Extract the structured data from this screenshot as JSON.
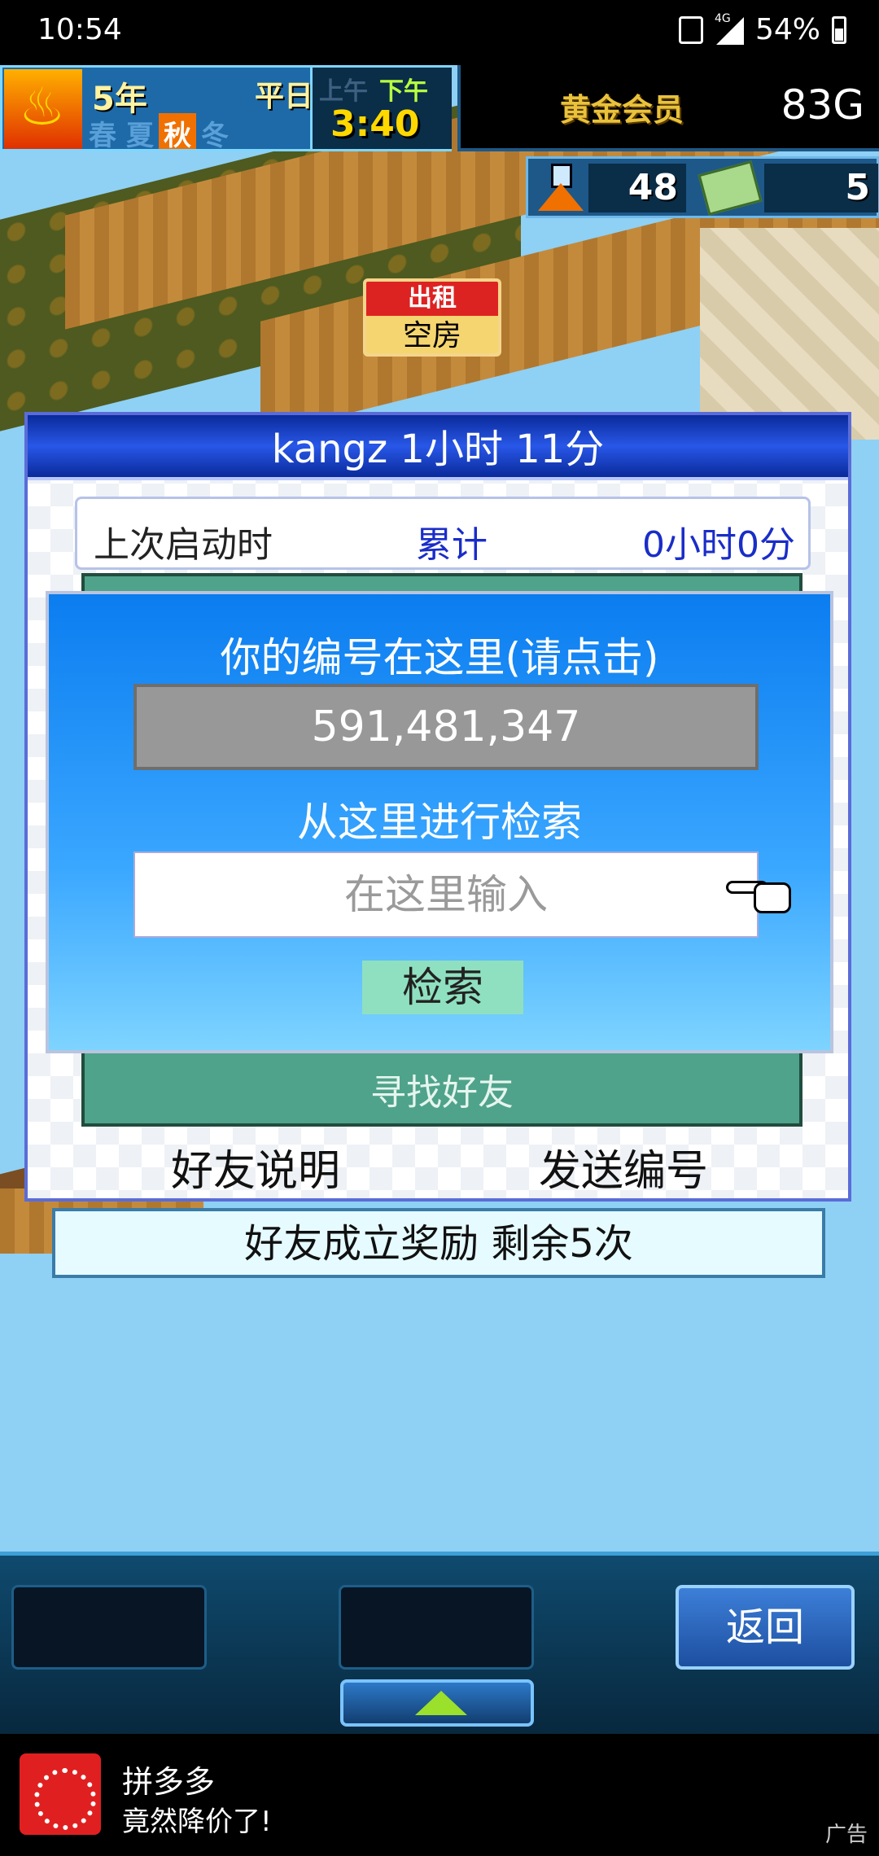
{
  "status_bar": {
    "time": "10:54",
    "network": "4G",
    "battery": "54%"
  },
  "hud": {
    "year": "5年",
    "weekday": "平日",
    "seasons": [
      "春",
      "夏",
      "秋",
      "冬"
    ],
    "active_season": "秋",
    "am": "上午",
    "pm": "下午",
    "clock": "3:40",
    "membership": "黄金会员",
    "gold": "83G",
    "research_points": "48",
    "tickets": "5"
  },
  "scene": {
    "vacancy_top": "出租",
    "vacancy_bottom": "空房"
  },
  "friend_panel": {
    "title": "kangz  1小时 11分",
    "last_launch_label": "上次启动时",
    "accumulated_label": "累计",
    "accumulated_value": "0小时0分",
    "find_friend_label": "寻找好友",
    "friend_explanation": "好友说明",
    "send_id": "发送编号",
    "bonus": "好友成立奖励  剩余5次"
  },
  "search_dialog": {
    "your_id_label": "你的编号在这里(请点击)",
    "your_id": "591,481,347",
    "search_here_label": "从这里进行检索",
    "input_placeholder": "在这里输入",
    "search_button": "检索"
  },
  "bottom_bar": {
    "back": "返回"
  },
  "ad": {
    "app_name": "拼多多",
    "tagline": "竟然降价了!",
    "label": "广告"
  }
}
